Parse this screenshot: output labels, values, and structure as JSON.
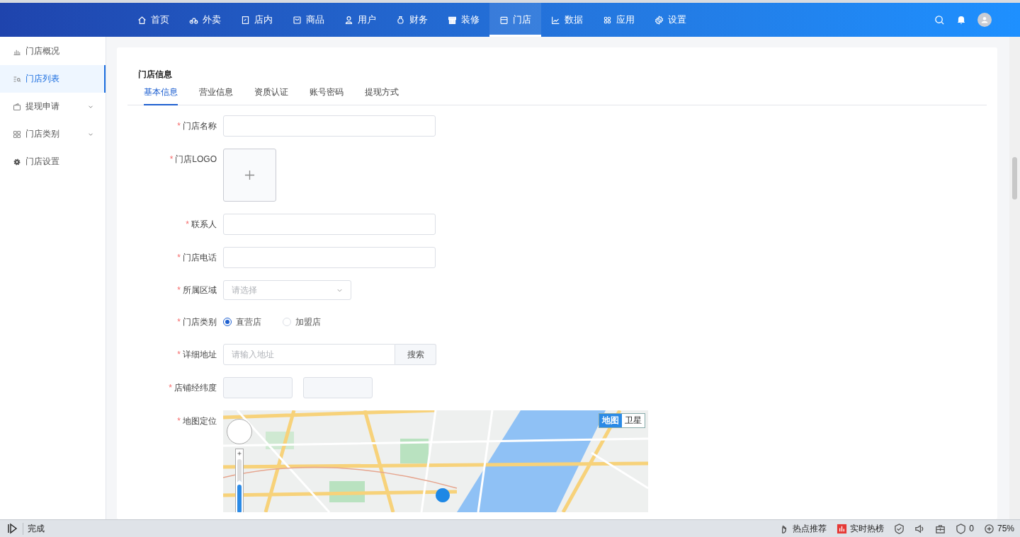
{
  "header": {
    "nav": [
      {
        "label": "首页",
        "selected": false
      },
      {
        "label": "外卖",
        "selected": false
      },
      {
        "label": "店内",
        "selected": false
      },
      {
        "label": "商品",
        "selected": false
      },
      {
        "label": "用户",
        "selected": false
      },
      {
        "label": "财务",
        "selected": false
      },
      {
        "label": "装修",
        "selected": false
      },
      {
        "label": "门店",
        "selected": true
      },
      {
        "label": "数据",
        "selected": false
      },
      {
        "label": "应用",
        "selected": false
      },
      {
        "label": "设置",
        "selected": false
      }
    ]
  },
  "sidebar": {
    "items": [
      {
        "label": "门店概况",
        "selected": false,
        "expandable": false
      },
      {
        "label": "门店列表",
        "selected": true,
        "expandable": false
      },
      {
        "label": "提现申请",
        "selected": false,
        "expandable": true
      },
      {
        "label": "门店类别",
        "selected": false,
        "expandable": true
      },
      {
        "label": "门店设置",
        "selected": false,
        "expandable": false
      }
    ]
  },
  "card": {
    "title": "门店信息",
    "tabs": [
      {
        "label": "基本信息",
        "selected": true
      },
      {
        "label": "营业信息",
        "selected": false
      },
      {
        "label": "资质认证",
        "selected": false
      },
      {
        "label": "账号密码",
        "selected": false
      },
      {
        "label": "提现方式",
        "selected": false
      }
    ],
    "form": [
      {
        "kind": "text",
        "label": "门店名称",
        "required_mark": "*"
      },
      {
        "kind": "upload",
        "label": "门店LOGO",
        "required_mark": "*"
      },
      {
        "kind": "text",
        "label": "联系人",
        "required_mark": "*"
      },
      {
        "kind": "text",
        "label": "门店电话",
        "required_mark": "*"
      },
      {
        "kind": "select",
        "label": "所属区域",
        "required_mark": "*",
        "placeholder": "请选择"
      },
      {
        "kind": "radio",
        "label": "门店类别",
        "required_mark": "*",
        "options": [
          {
            "label": "直营店",
            "selected": true
          },
          {
            "label": "加盟店",
            "selected": false
          }
        ]
      },
      {
        "kind": "search",
        "label": "详细地址",
        "required_mark": "*",
        "placeholder": "请输入地址",
        "button": "搜索"
      },
      {
        "kind": "coords",
        "label": "店铺经纬度",
        "required_mark": "*"
      },
      {
        "kind": "map",
        "label": "地图定位",
        "required_mark": "*",
        "zoom": {
          "level": 0.6
        },
        "map_types": [
          {
            "label": "地图",
            "selected": true
          },
          {
            "label": "卫星",
            "selected": false
          }
        ]
      }
    ]
  },
  "status_bar": {
    "status": "完成",
    "items": [
      {
        "label": "热点推荐"
      },
      {
        "label": "实时热榜"
      },
      {
        "label": "0"
      },
      {
        "label": "75%"
      }
    ]
  }
}
